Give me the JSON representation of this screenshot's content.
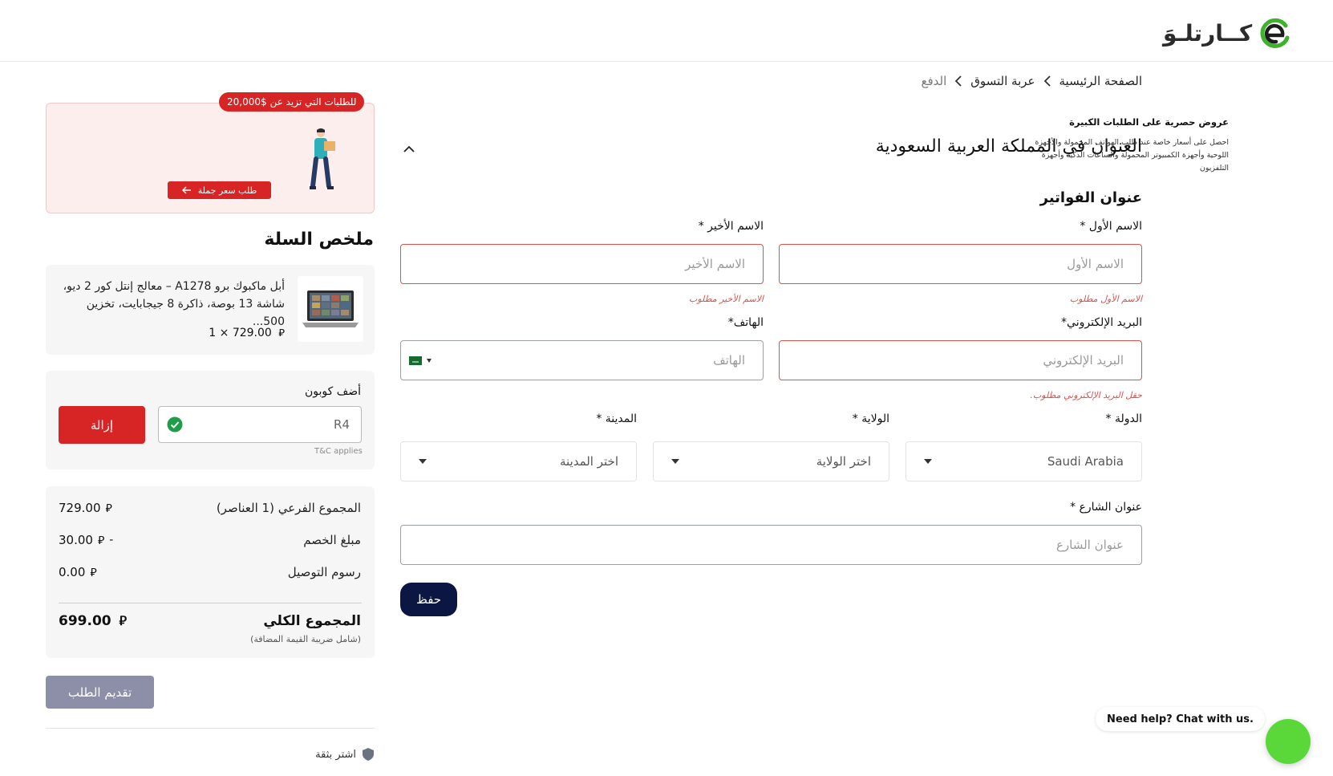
{
  "header": {
    "logo_text": "كــارتلـوَ"
  },
  "breadcrumb": {
    "home": "الصفحة الرئيسية",
    "cart": "عربة التسوق",
    "current": "الدفع"
  },
  "address": {
    "title": "العنوان في المملكة العربية السعودية",
    "billing_title": "عنوان الفواتير",
    "first_name": {
      "label": "الاسم الأول *",
      "placeholder": "الاسم الأول",
      "error": "الاسم الأول مطلوب"
    },
    "last_name": {
      "label": "الاسم الأخير *",
      "placeholder": "الاسم الأخير",
      "error": "الاسم الأخير مطلوب"
    },
    "email": {
      "label": "البريد الإلكتروني*",
      "placeholder": "البريد الإلكتروني",
      "error": "حقل البريد الإلكتروني مطلوب."
    },
    "phone": {
      "label": "الهاتف*",
      "placeholder": "الهاتف"
    },
    "country": {
      "label": "الدولة *",
      "value": "Saudi Arabia"
    },
    "state": {
      "label": "الولاية *",
      "value": "اختر الولاية"
    },
    "city": {
      "label": "المدينة *",
      "value": "اختر المدينة"
    },
    "street": {
      "label": "عنوان الشارع *",
      "placeholder": "عنوان الشارع"
    },
    "save_label": "حفظ"
  },
  "promo": {
    "badge": "للطلبات التي تزيد عن $20,000",
    "title": "عروض حصرية على الطلبات الكبيرة",
    "description": "احصل على أسعار خاصة عند طلب الهواتف المحمولة والأجهزة اللوحية وأجهزة الكمبيوتر المحمولة والساعات الذكية وأجهزة التلفزيون",
    "button": "طلب سعر جملة"
  },
  "cart": {
    "title": "ملخص السلة",
    "product_name": "أبل ماكبوك برو A1278 – معالج إنتل كور 2 ديو، شاشة 13 بوصة، ذاكرة 8 جيجابايت، تخزين 500...",
    "product_qty": "1 × 729.00",
    "coupon_label": "أضف كوبون",
    "coupon_value": "R4",
    "coupon_remove": "إزالة",
    "coupon_tc": "T&C applies",
    "subtotal_label": "المجموع الفرعي (1 العناصر)",
    "subtotal_value": "729.00",
    "discount_label": "مبلغ الخصم",
    "discount_value": "30.00",
    "shipping_label": "رسوم التوصيل",
    "shipping_value": "0.00",
    "grand_label": "المجموع الكلي",
    "grand_value": "699.00",
    "vat_note": "(شامل ضريبة القيمة المضافة)",
    "submit_label": "تقديم الطلب",
    "trust_label": "اشتر بثقة"
  },
  "chat": {
    "bubble": "Need help? Chat with us."
  },
  "colors": {
    "accent_red": "#d72424",
    "error_red": "#d9534f",
    "navy": "#0b1643",
    "brand_green": "#3fb12c",
    "chat_green": "#5ad83a"
  },
  "icons": {
    "logo": "cartlow-logo-icon",
    "chevron": "chevron-left-icon",
    "collapse": "chevron-up-icon",
    "check": "check-circle-icon",
    "shield": "shield-icon",
    "flag": "saudi-flag-icon"
  }
}
